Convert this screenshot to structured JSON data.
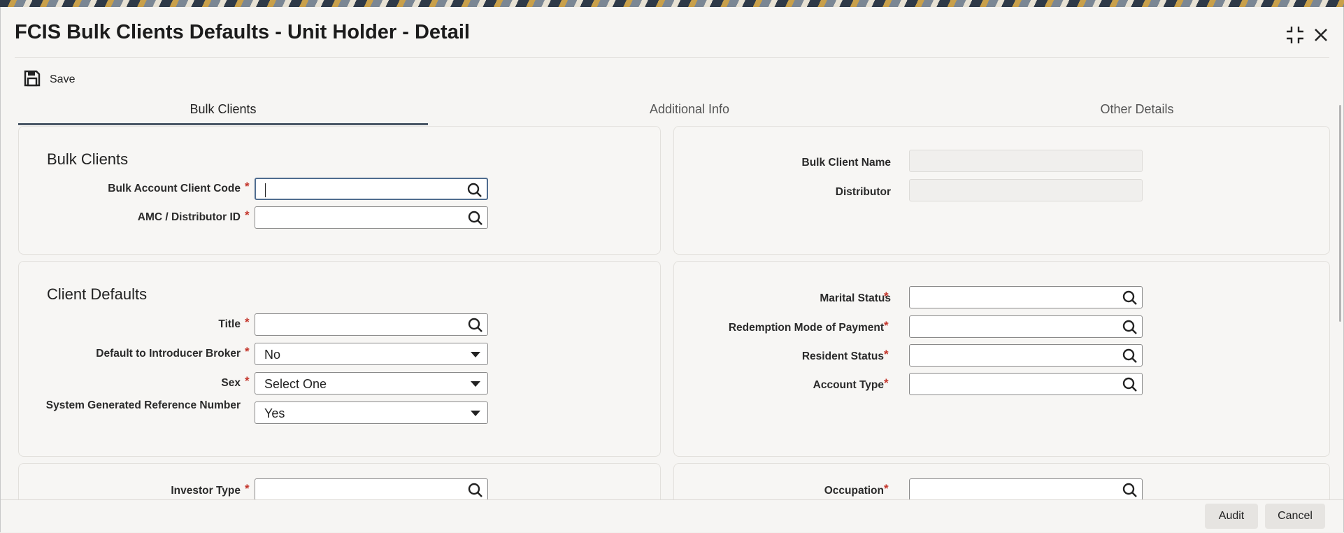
{
  "window": {
    "title": "FCIS Bulk Clients Defaults - Unit Holder - Detail"
  },
  "toolbar": {
    "save_label": "Save"
  },
  "tabs": [
    {
      "label": "Bulk Clients",
      "active": true
    },
    {
      "label": "Additional Info",
      "active": false
    },
    {
      "label": "Other Details",
      "active": false
    }
  ],
  "bulk_clients": {
    "section_title": "Bulk Clients",
    "bulk_account_client_code": {
      "label": "Bulk Account Client Code",
      "value": ""
    },
    "amc_distributor_id": {
      "label": "AMC / Distributor ID",
      "value": ""
    },
    "bulk_client_name": {
      "label": "Bulk Client Name",
      "value": ""
    },
    "distributor": {
      "label": "Distributor",
      "value": ""
    }
  },
  "client_defaults": {
    "section_title": "Client Defaults",
    "title": {
      "label": "Title",
      "value": ""
    },
    "default_to_introducer_broker": {
      "label": "Default to Introducer Broker",
      "value": "No"
    },
    "sex": {
      "label": "Sex",
      "value": "Select One"
    },
    "system_generated_reference_number": {
      "label": "System Generated Reference Number",
      "value": "Yes"
    },
    "marital_status": {
      "label": "Marital Status",
      "value": ""
    },
    "redemption_mode_of_payment": {
      "label": "Redemption Mode of Payment",
      "value": ""
    },
    "resident_status": {
      "label": "Resident Status",
      "value": ""
    },
    "account_type": {
      "label": "Account Type",
      "value": ""
    }
  },
  "investor": {
    "investor_type": {
      "label": "Investor Type",
      "value": ""
    },
    "occupation": {
      "label": "Occupation",
      "value": ""
    }
  },
  "required_marker": "*",
  "footer": {
    "audit_label": "Audit",
    "cancel_label": "Cancel"
  },
  "colors": {
    "required": "#c4362c",
    "tab_underline": "#4b5867",
    "focus_border": "#4f6c8f"
  }
}
